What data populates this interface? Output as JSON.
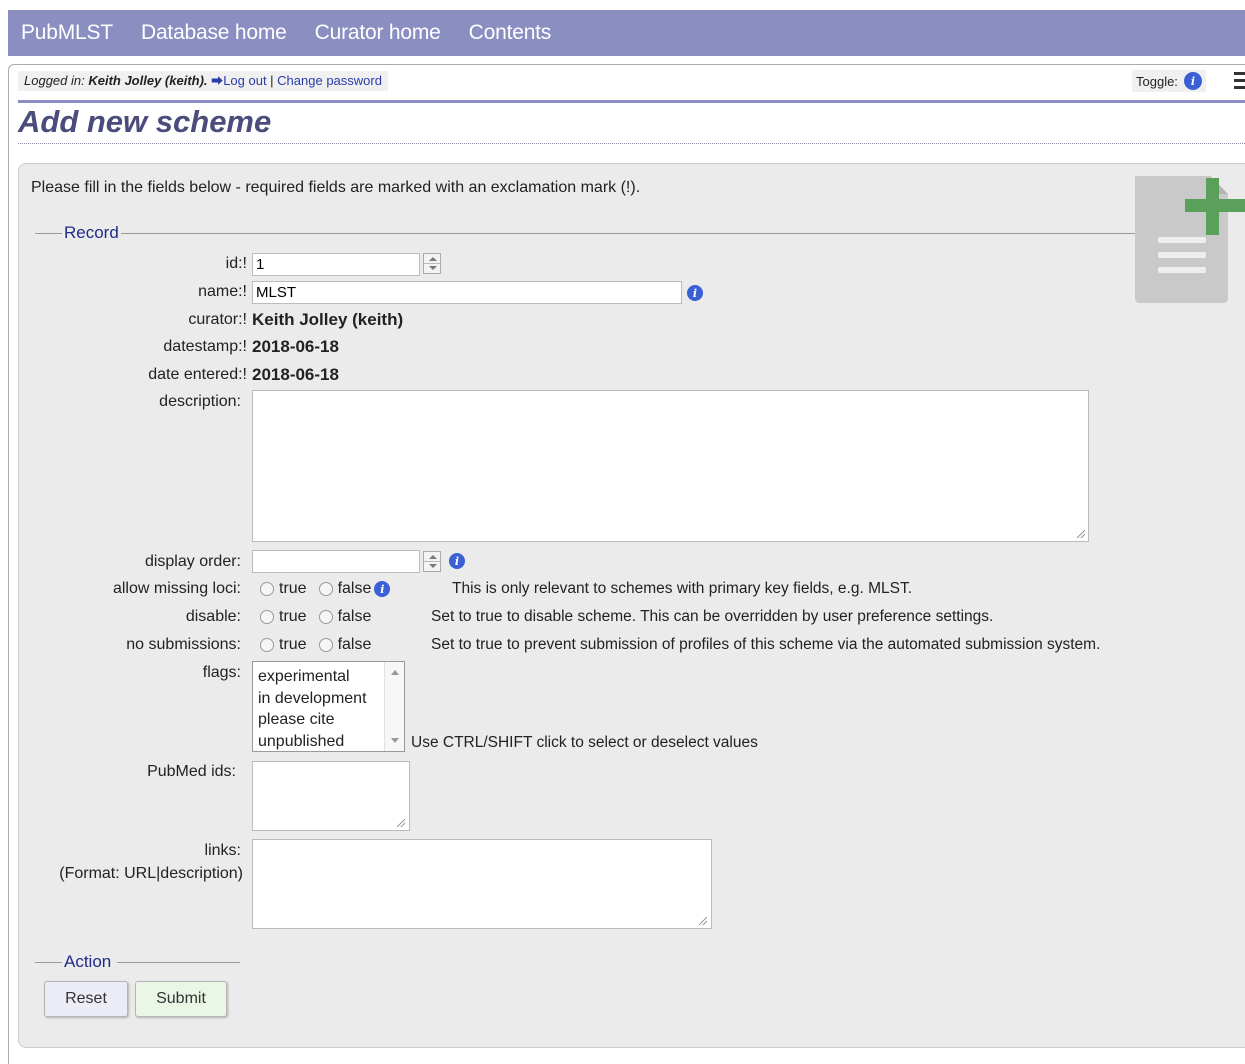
{
  "nav": {
    "items": [
      "PubMLST",
      "Database home",
      "Curator home",
      "Contents"
    ]
  },
  "login": {
    "prefix": "Logged in: ",
    "user": "Keith Jolley (keith).",
    "logout": "Log out",
    "separator": " | ",
    "change_password": "Change password"
  },
  "toggle": {
    "label": "Toggle:"
  },
  "page": {
    "title": "Add new scheme",
    "intro": "Please fill in the fields below - required fields are marked with an exclamation mark (!)."
  },
  "record": {
    "legend": "Record",
    "id": {
      "label": "id:!",
      "value": "1"
    },
    "name": {
      "label": "name:!",
      "value": "MLST"
    },
    "curator": {
      "label": "curator:!",
      "value": "Keith Jolley (keith)"
    },
    "datestamp": {
      "label": "datestamp:!",
      "value": "2018-06-18"
    },
    "date_entered": {
      "label": "date entered:!",
      "value": "2018-06-18"
    },
    "description": {
      "label": "description:",
      "value": ""
    },
    "display_order": {
      "label": "display order:",
      "value": ""
    },
    "allow_missing_loci": {
      "label": "allow missing loci:",
      "true_label": "true",
      "false_label": "false",
      "note": "This is only relevant to schemes with primary key fields, e.g. MLST."
    },
    "disable": {
      "label": "disable:",
      "true_label": "true",
      "false_label": "false",
      "note": "Set to true to disable scheme. This can be overridden by user preference settings."
    },
    "no_submissions": {
      "label": "no submissions:",
      "true_label": "true",
      "false_label": "false",
      "note": "Set to true to prevent submission of profiles of this scheme via the automated submission system."
    },
    "flags": {
      "label": "flags:",
      "options": [
        "experimental",
        "in development",
        "please cite",
        "unpublished"
      ],
      "note": "Use CTRL/SHIFT click to select or deselect values"
    },
    "pubmed": {
      "label": "PubMed ids:",
      "value": ""
    },
    "links": {
      "label": "links:",
      "format": "(Format: URL|description)",
      "value": ""
    }
  },
  "action": {
    "legend": "Action",
    "reset": "Reset",
    "submit": "Submit"
  },
  "colors": {
    "nav_bg": "#8b8ec1",
    "panel_bg": "#ebebeb",
    "info_icon": "#3b5fd4",
    "add_icon_plus": "#5aa05a",
    "title": "#4b4b7c"
  }
}
